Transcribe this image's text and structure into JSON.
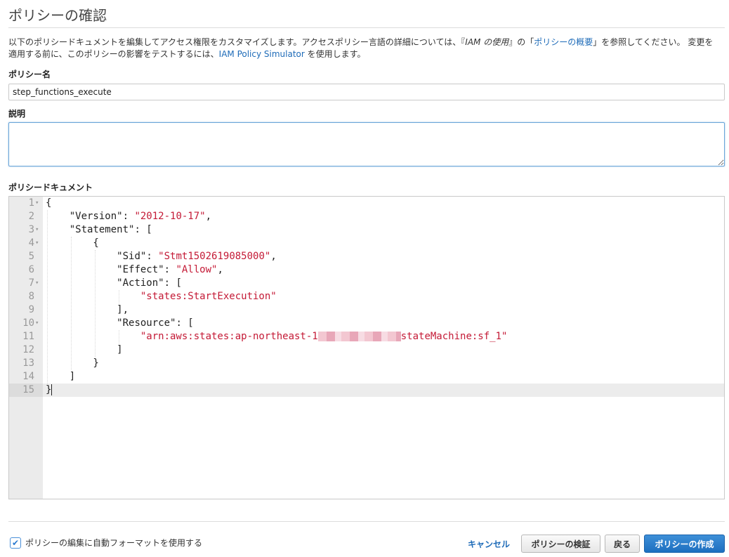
{
  "header": {
    "title": "ポリシーの確認"
  },
  "intro": {
    "part1": "以下のポリシードキュメントを編集してアクセス権限をカスタマイズします。アクセスポリシー言語の詳細については、『",
    "doc_title": "IAM の使用",
    "part2": "』の「",
    "overview_link": "ポリシーの概要",
    "part3": "」を参照してください。 変更を適用する前に、このポリシーの影響をテストするには、",
    "simulator_link": "IAM Policy Simulator",
    "part4": " を使用します。"
  },
  "form": {
    "policy_name_label": "ポリシー名",
    "policy_name_value": "step_functions_execute",
    "description_label": "説明",
    "description_value": "",
    "document_label": "ポリシードキュメント"
  },
  "editor": {
    "lines": [
      {
        "n": "1",
        "fold": true
      },
      {
        "n": "2",
        "key": "\"Version\"",
        "val": "\"2012-10-17\""
      },
      {
        "n": "3",
        "fold": true,
        "key": "\"Statement\""
      },
      {
        "n": "4",
        "fold": true
      },
      {
        "n": "5",
        "key": "\"Sid\"",
        "val": "\"Stmt1502619085000\""
      },
      {
        "n": "6",
        "key": "\"Effect\"",
        "val": "\"Allow\""
      },
      {
        "n": "7",
        "fold": true,
        "key": "\"Action\""
      },
      {
        "n": "8",
        "val": "\"states:StartExecution\""
      },
      {
        "n": "9"
      },
      {
        "n": "10",
        "fold": true,
        "key": "\"Resource\""
      },
      {
        "n": "11",
        "val_prefix": "\"arn:aws:states:ap-northeast-1",
        "val_suffix": "stateMachine:sf_1\""
      },
      {
        "n": "12"
      },
      {
        "n": "13"
      },
      {
        "n": "14"
      },
      {
        "n": "15"
      }
    ]
  },
  "footer": {
    "autoformat_label": "ポリシーの編集に自動フォーマットを使用する",
    "autoformat_checked": true,
    "cancel_label": "キャンセル",
    "validate_label": "ポリシーの検証",
    "back_label": "戻る",
    "create_label": "ポリシーの作成"
  }
}
